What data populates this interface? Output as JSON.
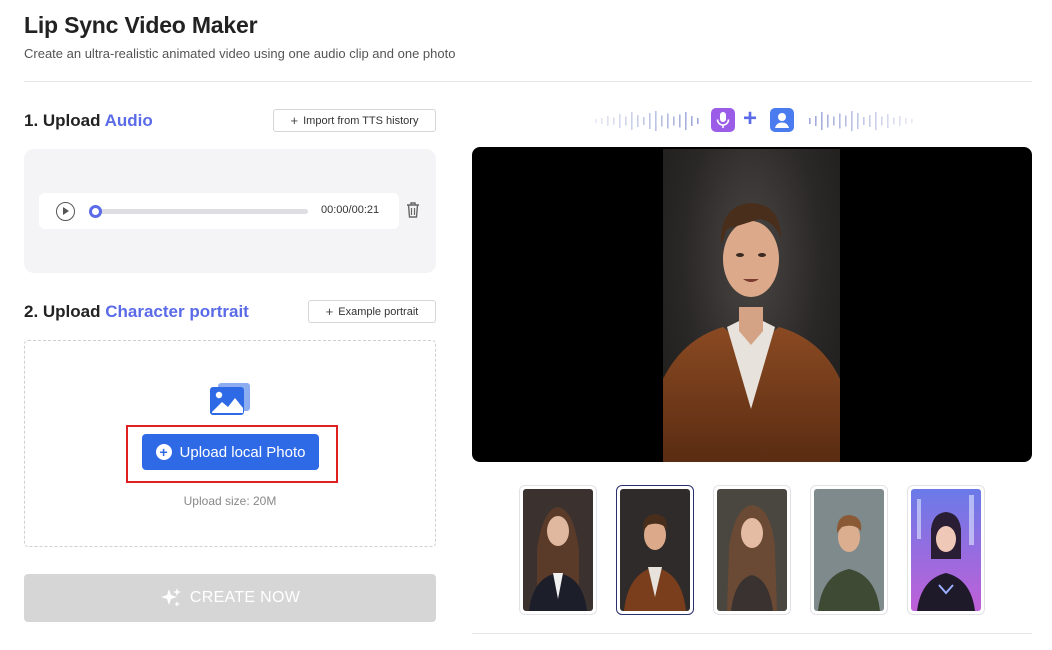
{
  "header": {
    "title": "Lip Sync Video Maker",
    "subtitle": "Create an ultra-realistic animated video using one audio clip and one photo"
  },
  "audio_section": {
    "title_prefix": "1. Upload ",
    "title_accent": "Audio",
    "import_button": "Import from TTS history",
    "player": {
      "current_time": "00:00",
      "duration": "00:21",
      "progress": 0
    }
  },
  "portrait_section": {
    "title_prefix": "2. Upload ",
    "title_accent": "Character portrait",
    "example_button": "Example portrait",
    "upload_button": "Upload local Photo",
    "upload_size": "Upload size: 20M"
  },
  "create_button": "CREATE NOW",
  "thumbnails": [
    {
      "name": "woman-suit",
      "selected": false
    },
    {
      "name": "man-brown-blazer",
      "selected": true
    },
    {
      "name": "woman-long-hair",
      "selected": false
    },
    {
      "name": "man-green-shirt",
      "selected": false
    },
    {
      "name": "cyber-girl",
      "selected": false
    }
  ],
  "colors": {
    "accent": "#5b6be8",
    "primary_button": "#2f6ae6",
    "highlight_border": "#e02020",
    "disabled_button": "#d6d6d6"
  }
}
